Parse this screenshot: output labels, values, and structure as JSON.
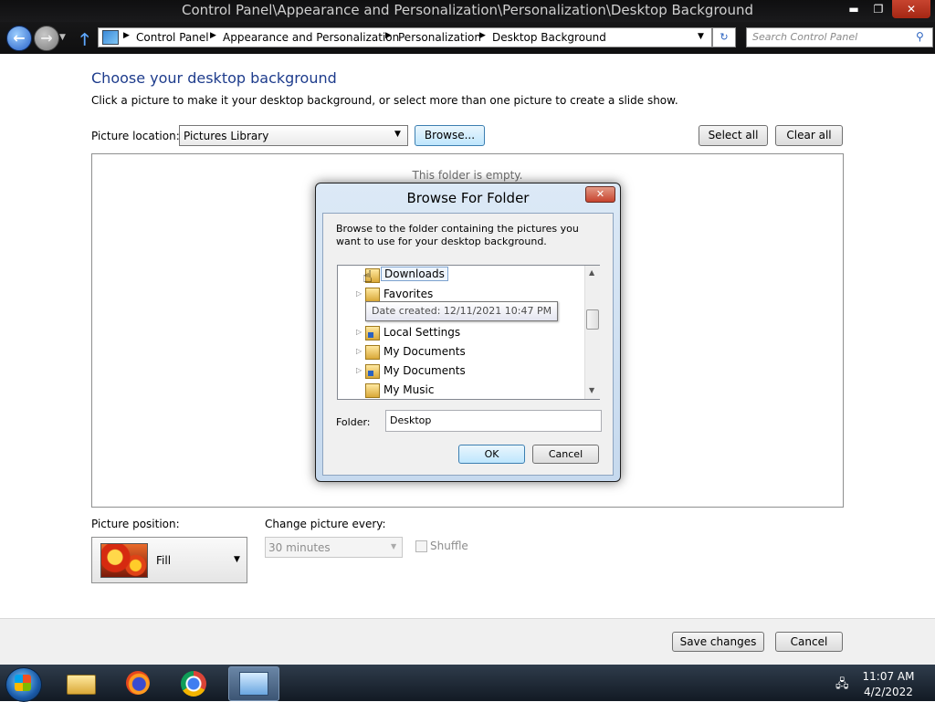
{
  "window": {
    "title": "Control Panel\\Appearance and Personalization\\Personalization\\Desktop Background",
    "min_glyph": "▬",
    "max_glyph": "❐",
    "close_glyph": "✕"
  },
  "nav": {
    "back_glyph": "←",
    "fwd_glyph": "→",
    "drop_glyph": "▼",
    "up_glyph": "🡑",
    "refresh_glyph": "↻",
    "search_glyph": "⚲",
    "breadcrumbs": [
      "Control Panel",
      "Appearance and Personalization",
      "Personalization",
      "Desktop Background"
    ],
    "sep_glyph": "▶",
    "search_placeholder": "Search Control Panel"
  },
  "content": {
    "heading": "Choose your desktop background",
    "subheading": "Click a picture to make it your desktop background, or select more than one picture to create a slide show.",
    "location_label": "Picture location:",
    "location_value": "Pictures Library",
    "browse_label": "Browse...",
    "select_all_label": "Select all",
    "clear_all_label": "Clear all",
    "empty_message": "This folder is empty.",
    "position_label": "Picture position:",
    "position_value": "Fill",
    "change_label": "Change picture every:",
    "change_value": "30 minutes",
    "shuffle_label": "Shuffle",
    "save_label": "Save changes",
    "cancel_label": "Cancel",
    "drop_glyph": "▼"
  },
  "dialog": {
    "title": "Browse For Folder",
    "close_glyph": "✕",
    "description": "Browse to the folder containing the pictures you want to use for your desktop background.",
    "tree": [
      {
        "label": "Downloads",
        "expand": "",
        "shortcut": false
      },
      {
        "label": "Favorites",
        "expand": "▷",
        "shortcut": false
      },
      {
        "label": "",
        "expand": "",
        "shortcut": false
      },
      {
        "label": "Local Settings",
        "expand": "▷",
        "shortcut": true
      },
      {
        "label": "My Documents",
        "expand": "▷",
        "shortcut": false
      },
      {
        "label": "My Documents",
        "expand": "▷",
        "shortcut": true
      },
      {
        "label": "My Music",
        "expand": "",
        "shortcut": false
      }
    ],
    "tooltip": "Date created: 12/11/2021 10:47 PM",
    "folder_label": "Folder:",
    "folder_value": "Desktop",
    "ok_label": "OK",
    "cancel_label": "Cancel",
    "scroll_up": "▲",
    "scroll_down": "▼",
    "cursor_glyph": "☝"
  },
  "taskbar": {
    "tray_glyph": "🖧",
    "time": "11:07 AM",
    "date": "4/2/2022"
  }
}
